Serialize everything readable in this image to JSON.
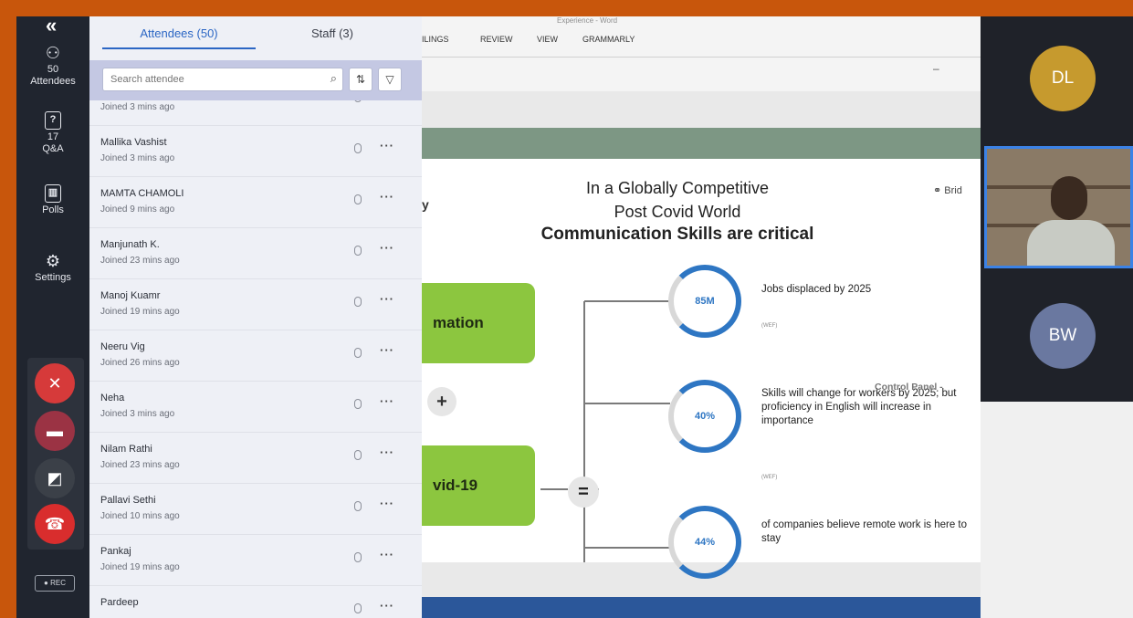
{
  "rail": {
    "collapse_glyph": "«",
    "attendees_count": "50",
    "attendees_label": "Attendees",
    "qa_count": "17",
    "qa_label": "Q&A",
    "polls_label": "Polls",
    "settings_label": "Settings",
    "rec_label": "REC"
  },
  "panel": {
    "tabs": [
      "Attendees (50)",
      "Staff (3)"
    ],
    "search_placeholder": "Search attendee",
    "attendees": [
      {
        "name": "",
        "sub": "Joined 3 mins ago"
      },
      {
        "name": "Mallika Vashist",
        "sub": "Joined 3 mins ago"
      },
      {
        "name": "MAMTA CHAMOLI",
        "sub": "Joined 9 mins ago"
      },
      {
        "name": "Manjunath K.",
        "sub": "Joined 23 mins ago"
      },
      {
        "name": "Manoj Kuamr",
        "sub": "Joined 19 mins ago"
      },
      {
        "name": "Neeru Vig",
        "sub": "Joined 26 mins ago"
      },
      {
        "name": "Neha",
        "sub": "Joined 3 mins ago"
      },
      {
        "name": "Nilam Rathi",
        "sub": "Joined 23 mins ago"
      },
      {
        "name": "Pallavi Sethi",
        "sub": "Joined 10 mins ago"
      },
      {
        "name": "Pankaj",
        "sub": "Joined 19 mins ago"
      },
      {
        "name": "Pardeep",
        "sub": ""
      }
    ]
  },
  "word": {
    "title": "Experience - Word",
    "ribbon": [
      "ILINGS",
      "REVIEW",
      "VIEW",
      "GRAMMARLY"
    ]
  },
  "slide": {
    "title_line1": "In a Globally Competitive",
    "title_line2": "Post Covid World",
    "title_line3": "Communication Skills are critical",
    "left_fragment": "y",
    "logo_text": "Brid",
    "box1": "mation",
    "box2": "vid-19",
    "plus": "+",
    "equals": "=",
    "stats": [
      {
        "pct": "85M",
        "text": "Jobs displaced by 2025",
        "src": "(WEF)"
      },
      {
        "pct": "40%",
        "text": "Skills will change for workers by 2025; but proficiency in English will increase in importance",
        "src": "(WEF)"
      },
      {
        "pct": "44%",
        "text": "of companies believe remote work is here to stay",
        "src": ""
      }
    ],
    "control_panel": "Control Panel -"
  },
  "videos": {
    "tile1": {
      "initials": "DL",
      "color": "#c69a2e"
    },
    "tile3": {
      "initials": "BW",
      "color": "#6a78a0"
    }
  }
}
